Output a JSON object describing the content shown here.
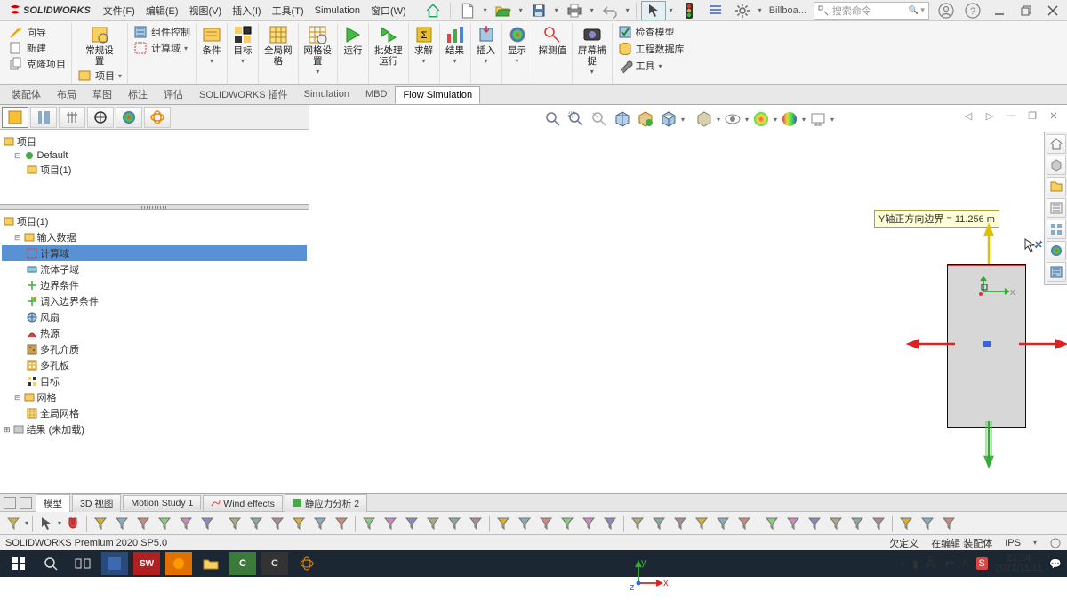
{
  "app": {
    "name": "SOLIDWORKS"
  },
  "menus": [
    "文件(F)",
    "编辑(E)",
    "视图(V)",
    "插入(I)",
    "工具(T)",
    "Simulation",
    "窗口(W)"
  ],
  "qat_label": "Billboa...",
  "search": {
    "placeholder": "搜索命令"
  },
  "ribbon": {
    "g1": {
      "a": "向导",
      "b": "新建",
      "c": "克隆项目"
    },
    "g2": {
      "a": "常规设\n置",
      "b": "项目"
    },
    "g3": {
      "a": "组件控制",
      "b": "计算域"
    },
    "g4": {
      "a": "条件",
      "b": "目标"
    },
    "g5": {
      "a": "全局网\n格",
      "b": "网格设\n置"
    },
    "g6": "运行",
    "g7": "批处理\n运行",
    "g8": "求解",
    "g9": "结果",
    "g10": "插入",
    "g11": "显示",
    "g12": "探测值",
    "g13": "屏幕捕\n捉",
    "g14": {
      "a": "检查模型",
      "b": "工程数据库",
      "c": "工具"
    }
  },
  "tabs": [
    "装配体",
    "布局",
    "草图",
    "标注",
    "评估",
    "SOLIDWORKS 插件",
    "Simulation",
    "MBD",
    "Flow Simulation"
  ],
  "tabs_active": 8,
  "tree1": {
    "root": "项目",
    "n1": "Default",
    "n2": "项目(1)"
  },
  "tree2": {
    "root": "项目(1)",
    "n_input": "输入数据",
    "items": [
      "计算域",
      "流体子域",
      "边界条件",
      "调入边界条件",
      "风扇",
      "热源",
      "多孔介质",
      "多孔板",
      "目标"
    ],
    "sel_index": 0,
    "mesh": "网格",
    "mesh_child": "全局网格",
    "results": "结果 (未加载)"
  },
  "tooltip": "Y轴正方向边界 = 11.256 m",
  "btabs": [
    "模型",
    "3D 视图",
    "Motion Study 1",
    "Wind effects",
    "静应力分析 2"
  ],
  "status": {
    "left": "SOLIDWORKS Premium 2020 SP5.0",
    "r1": "欠定义",
    "r2": "在编辑 装配体",
    "r3": "IPS"
  },
  "clock": {
    "time": "21:14",
    "date": "2021/11/11"
  }
}
